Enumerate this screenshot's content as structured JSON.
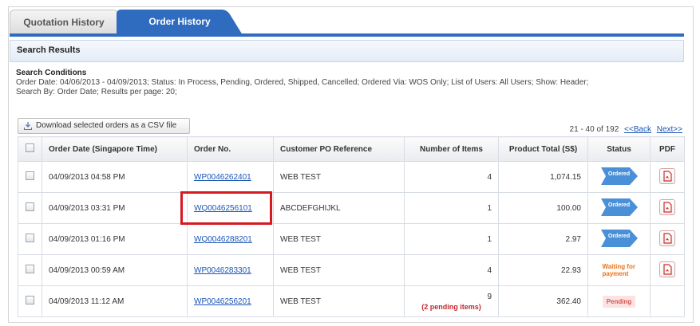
{
  "tabs": [
    {
      "label": "Quotation History",
      "active": false
    },
    {
      "label": "Order History",
      "active": true
    }
  ],
  "results_header": "Search Results",
  "conditions": {
    "title": "Search Conditions",
    "line1": "Order Date: 04/06/2013 - 04/09/2013;   Status: In Process, Pending, Ordered, Shipped, Cancelled;   Ordered Via: WOS Only;   List of Users: All Users;   Show: Header;",
    "line2": "Search By: Order Date;   Results per page: 20;"
  },
  "download_label": "Download selected orders as a CSV file",
  "pager": {
    "range": "21 - 40 of 192",
    "back": "<<Back",
    "next": "Next>>"
  },
  "columns": [
    "Order Date (Singapore Time)",
    "Order No.",
    "Customer PO Reference",
    "Number of Items",
    "Product Total (S$)",
    "Status",
    "PDF"
  ],
  "rows": [
    {
      "date": "04/09/2013 04:58 PM",
      "order_no": "WP0046262401",
      "po": "WEB TEST",
      "items": "4",
      "items_note": "",
      "total": "1,074.15",
      "status": "Ordered"
    },
    {
      "date": "04/09/2013 03:31 PM",
      "order_no": "WQ0046256101",
      "po": "ABCDEFGHIJKL",
      "items": "1",
      "items_note": "",
      "total": "100.00",
      "status": "Ordered"
    },
    {
      "date": "04/09/2013 01:16 PM",
      "order_no": "WQ0046288201",
      "po": "WEB TEST",
      "items": "1",
      "items_note": "",
      "total": "2.97",
      "status": "Ordered"
    },
    {
      "date": "04/09/2013 00:59 AM",
      "order_no": "WP0046283301",
      "po": "WEB TEST",
      "items": "4",
      "items_note": "",
      "total": "22.93",
      "status": "Waiting for payment"
    },
    {
      "date": "04/09/2013 11:12 AM",
      "order_no": "WP0046256201",
      "po": "WEB TEST",
      "items": "9",
      "items_note": "(2 pending items)",
      "total": "362.40",
      "status": "Pending"
    }
  ],
  "colors": {
    "tab_active": "#2f6cc0",
    "link": "#1a55b5",
    "highlight": "#d71920",
    "ordered": "#4a90d9",
    "waiting": "#e8731a",
    "pending": "#d9534f"
  },
  "icons": {
    "download": "download-icon",
    "pdf": "pdf-icon",
    "checkbox": "checkbox-icon",
    "status_arrow": "status-arrow-icon"
  }
}
